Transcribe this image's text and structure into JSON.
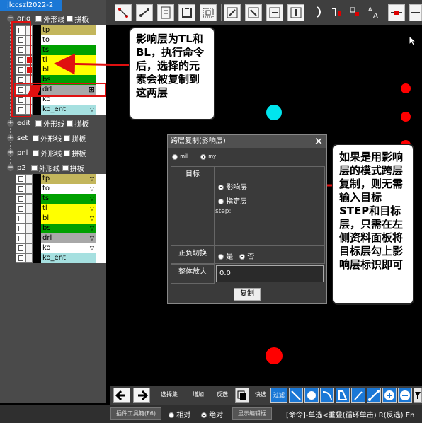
{
  "job_tab": "jlccszl2022-2",
  "groups": [
    {
      "name": "orig",
      "expanded": true,
      "outline_label": "外形线",
      "panel_label": "拼板"
    },
    {
      "name": "edit",
      "expanded": false,
      "outline_label": "外形线",
      "panel_label": "拼板"
    },
    {
      "name": "set",
      "expanded": false,
      "outline_label": "外形线",
      "panel_label": "拼板"
    },
    {
      "name": "pnl",
      "expanded": false,
      "outline_label": "外形线",
      "panel_label": "拼板"
    },
    {
      "name": "p2",
      "expanded": true,
      "outline_label": "外形线",
      "panel_label": "拼板"
    }
  ],
  "orig_layers": [
    {
      "name": "tp",
      "color": "#c3b65c",
      "affected": false,
      "has_menu": false
    },
    {
      "name": "to",
      "color": "#ffffff",
      "affected": false,
      "has_menu": false
    },
    {
      "name": "ts",
      "color": "#00a000",
      "affected": false,
      "has_menu": false
    },
    {
      "name": "tl",
      "color": "#ffff00",
      "affected": true,
      "has_menu": false
    },
    {
      "name": "bl",
      "color": "#ffff00",
      "affected": true,
      "has_menu": false
    },
    {
      "name": "bs",
      "color": "#00a000",
      "affected": false,
      "has_menu": false
    },
    {
      "name": "drl",
      "color": "#a8a8a8",
      "affected": false,
      "has_menu": false
    },
    {
      "name": "ko",
      "color": "#ffffff",
      "affected": false,
      "has_menu": false
    },
    {
      "name": "ko_ent",
      "color": "#a6e0e0",
      "affected": false,
      "has_menu": true
    }
  ],
  "p2_layers": [
    {
      "name": "tp",
      "color": "#c3b65c",
      "has_menu": true
    },
    {
      "name": "to",
      "color": "#ffffff",
      "has_menu": true
    },
    {
      "name": "ts",
      "color": "#00a000",
      "has_menu": true
    },
    {
      "name": "tl",
      "color": "#ffff00",
      "has_menu": true
    },
    {
      "name": "bl",
      "color": "#ffff00",
      "has_menu": true
    },
    {
      "name": "bs",
      "color": "#00a000",
      "has_menu": true
    },
    {
      "name": "drl",
      "color": "#a8a8a8",
      "has_menu": true
    },
    {
      "name": "ko",
      "color": "#ffffff",
      "has_menu": true
    },
    {
      "name": "ko_ent",
      "color": "#a6e0e0",
      "has_menu": false
    }
  ],
  "callout_left": "影响层为TL和BL，执行命令后，选择的元素会被复制到这两层",
  "callout_right": "如果是用影响层的模式跨层复制，则无需输入目标STEP和目标层，只需在左侧资料面板将目标层勾上影响层标识即可",
  "dialog": {
    "title": "跨层复制(影响层)",
    "close_glyph": "✕",
    "unit_mil": "mil",
    "unit_my": "my",
    "target_label": "目标",
    "option_affected": "影响层",
    "option_specified": "指定层",
    "step_label": "step:",
    "polarity_label": "正负切换",
    "polarity_yes": "是",
    "polarity_no": "否",
    "scale_label": "整体放大",
    "scale_value": "0.0",
    "copy_button": "复制"
  },
  "bottom_toolbar": {
    "select_set": "选择集",
    "add": "增加",
    "invert": "反选",
    "quick": "快选",
    "filter": "过滤"
  },
  "status_bar": {
    "plugin_toolbox": "插件工具箱(F6)",
    "relative": "相对",
    "absolute": "绝对",
    "show_edit_box": "显示编辑框",
    "command_text": "[命令]-单选<重叠(循环单击) R(反选) En"
  },
  "colors": {
    "accent_blue": "#1b78d6",
    "highlight_red": "#e01010",
    "cyan_pad": "#00e5ee",
    "red_pad": "#ff0000"
  }
}
